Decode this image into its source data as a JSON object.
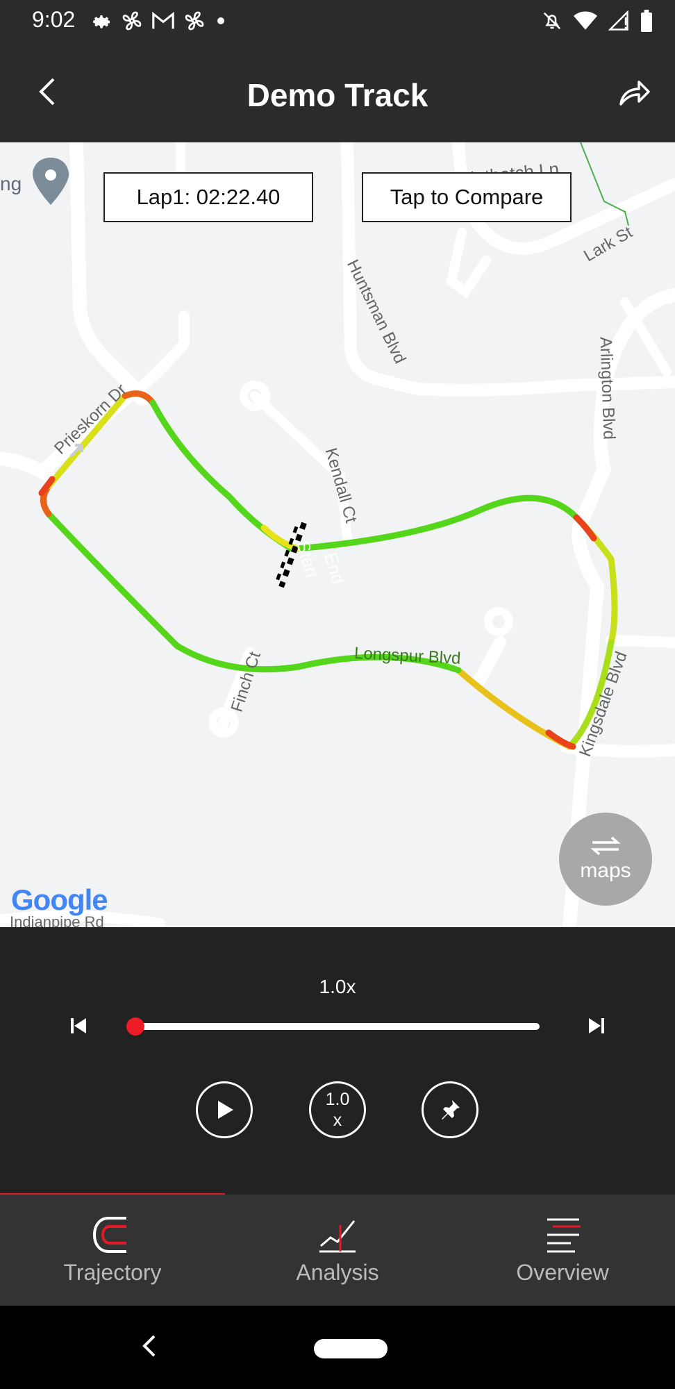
{
  "status_bar": {
    "time": "9:02",
    "left_icons": [
      "settings-icon",
      "fan-icon",
      "gmail-icon",
      "fan-icon",
      "dot-icon"
    ],
    "right_icons": [
      "notifications-off-icon",
      "wifi-icon",
      "signal-icon",
      "battery-icon"
    ]
  },
  "app_bar": {
    "title": "Demo Track"
  },
  "map": {
    "lap_label": "Lap1: 02:22.40",
    "compare_label": "Tap to Compare",
    "toggle_label": "maps",
    "attribution": "Google",
    "street_labels": {
      "nuthatch": "Nuthatch Ln",
      "lark": "Lark St",
      "huntsman": "Huntsman Blvd",
      "arlington": "Arlington Blvd",
      "kendall": "Kendall Ct",
      "prieskorn": "Prieskorn Dr",
      "finch": "Finch Ct",
      "longspur": "Longspur Blvd",
      "kingsdale": "Kingsdale Blvd",
      "indianpipe": "Indianpipe Rd",
      "place_partial": "ng"
    },
    "marker_labels": {
      "start": "Start",
      "end": "End"
    },
    "track_colors": {
      "fast": "#55d61b",
      "medium": "#e8e21a",
      "slow": "#e8431a"
    }
  },
  "player": {
    "speed_label": "1.0x",
    "speed_button_top": "1.0",
    "speed_button_bottom": "x",
    "progress": 0.0,
    "accent_color": "#ee1c25"
  },
  "bottom_nav": {
    "items": [
      {
        "label": "Trajectory",
        "icon": "trajectory-icon",
        "selected": true
      },
      {
        "label": "Analysis",
        "icon": "analysis-icon",
        "selected": false
      },
      {
        "label": "Overview",
        "icon": "overview-icon",
        "selected": false
      }
    ]
  }
}
